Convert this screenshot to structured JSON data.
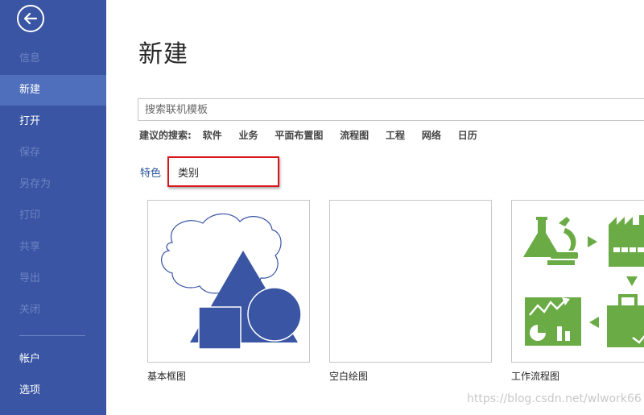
{
  "sidebar": {
    "items": [
      {
        "label": "信息"
      },
      {
        "label": "新建"
      },
      {
        "label": "打开"
      },
      {
        "label": "保存"
      },
      {
        "label": "另存为"
      },
      {
        "label": "打印"
      },
      {
        "label": "共享"
      },
      {
        "label": "导出"
      },
      {
        "label": "关闭"
      },
      {
        "label": "帐户"
      },
      {
        "label": "选项"
      }
    ],
    "active": "新建"
  },
  "main": {
    "title": "新建",
    "search": {
      "placeholder": "搜索联机模板",
      "value": ""
    },
    "suggested": {
      "label": "建议的搜索:",
      "links": [
        "软件",
        "业务",
        "平面布置图",
        "流程图",
        "工程",
        "网络",
        "日历"
      ]
    },
    "tabs": {
      "featured": "特色",
      "category": "类别"
    },
    "templates": [
      {
        "label": "基本框图",
        "icon": "basic-shapes-icon"
      },
      {
        "label": "空白绘图",
        "icon": "blank-drawing"
      },
      {
        "label": "工作流程图",
        "icon": "workflow-icon"
      }
    ]
  },
  "colors": {
    "sidebar_bg": "#3955a3",
    "active_item_bg": "#4f6fbd",
    "shape_blue": "#3955a3",
    "workflow_green": "#6aab45",
    "highlight_red": "#d9161c"
  },
  "watermark": "https://blog.csdn.net/wlwork66"
}
